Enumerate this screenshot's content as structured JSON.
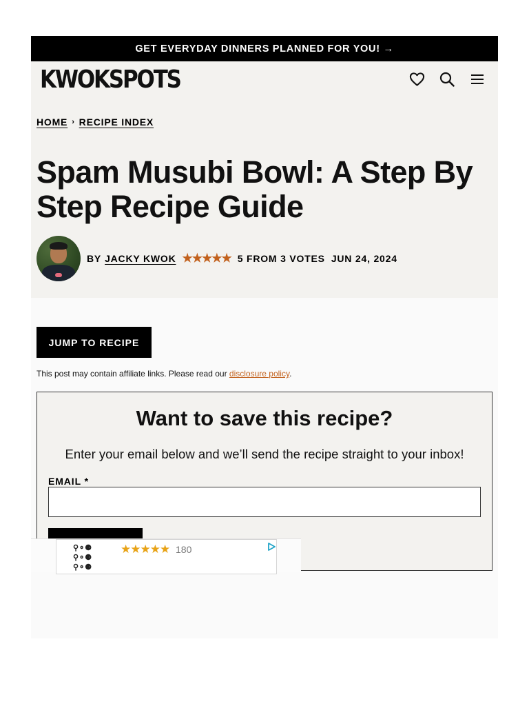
{
  "promo": {
    "text": "GET EVERYDAY DINNERS PLANNED FOR YOU! →"
  },
  "header": {
    "logo": "KWOKSPOTS",
    "icons": [
      "heart-icon",
      "search-icon",
      "menu-icon"
    ]
  },
  "breadcrumb": {
    "home": "HOME",
    "separator": "›",
    "index": "RECIPE INDEX"
  },
  "article": {
    "title": "Spam Musubi Bowl: A Step By Step Recipe Guide",
    "by_label": "BY",
    "author": "JACKY KWOK",
    "stars": "★★★★★",
    "rating_text": "5 FROM 3 VOTES",
    "date": "JUN 24, 2024",
    "rating_value": 5,
    "rating_max": 5
  },
  "actions": {
    "jump_label": "JUMP TO RECIPE"
  },
  "affiliate": {
    "text": "This post may contain affiliate links. Please read our ",
    "link": "disclosure policy",
    "end": "."
  },
  "save_form": {
    "title": "Want to save this recipe?",
    "subtitle": "Enter your email below and we’ll send the recipe straight to your inbox!",
    "email_label": "EMAIL *",
    "email_value": "",
    "button_label": ""
  },
  "ad": {
    "glyph_rows": [
      "⚲⚬⚈",
      "⚲⚬⚈",
      "⚲⚬⚈"
    ],
    "stars": "★★★★★",
    "rating_value": 4.5,
    "count": "180",
    "icon": "ad-choices-play-icon"
  },
  "colors": {
    "accent": "#c2611d",
    "header_bg": "#f3f2ef",
    "promo_bg": "#000000",
    "ad_star": "#e8a317"
  }
}
